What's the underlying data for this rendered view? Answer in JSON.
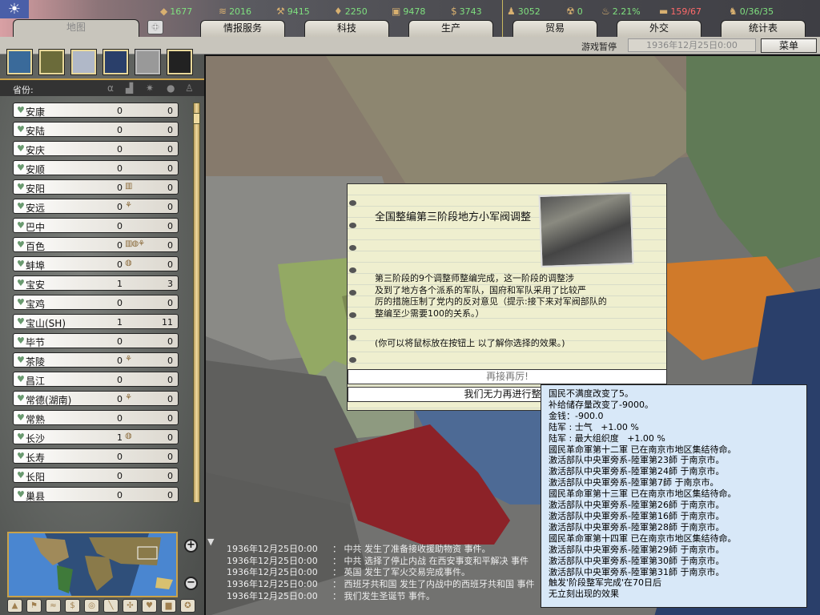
{
  "topbar": {
    "resources": [
      {
        "icon": "energy-icon",
        "value": "1677"
      },
      {
        "icon": "metal-icon",
        "value": "2016"
      },
      {
        "icon": "rare-materials-icon",
        "value": "9415"
      },
      {
        "icon": "oil-icon",
        "value": "2250"
      },
      {
        "icon": "supplies-icon",
        "value": "9478"
      },
      {
        "icon": "money-icon",
        "value": "3743"
      },
      {
        "icon": "manpower-icon",
        "value": "3052"
      },
      {
        "icon": "nuclear-icon",
        "value": "0"
      },
      {
        "icon": "dissent-icon",
        "value": "2.21%"
      },
      {
        "icon": "transport-icon",
        "value": "159/67",
        "color": "#ff6a6a"
      },
      {
        "icon": "officers-icon",
        "value": "0/36/35"
      }
    ],
    "tabs": [
      "地图",
      "情报服务",
      "科技",
      "生产",
      "贸易",
      "外交",
      "统计表"
    ],
    "paused": "游戏暂停",
    "date": "1936年12月25日0:00",
    "menu": "菜单"
  },
  "sidebar": {
    "header": "省份:",
    "rows": [
      {
        "name": "安康",
        "v1": "0",
        "v2": "0",
        "b": ""
      },
      {
        "name": "安陆",
        "v1": "0",
        "v2": "0",
        "b": ""
      },
      {
        "name": "安庆",
        "v1": "0",
        "v2": "0",
        "b": ""
      },
      {
        "name": "安顺",
        "v1": "0",
        "v2": "0",
        "b": ""
      },
      {
        "name": "安阳",
        "v1": "0",
        "v2": "0",
        "b": "▥"
      },
      {
        "name": "安远",
        "v1": "0",
        "v2": "0",
        "b": "⚘"
      },
      {
        "name": "巴中",
        "v1": "0",
        "v2": "0",
        "b": ""
      },
      {
        "name": "百色",
        "v1": "0",
        "v2": "0",
        "b": "▥◍⚘"
      },
      {
        "name": "蚌埠",
        "v1": "0",
        "v2": "0",
        "b": "◍"
      },
      {
        "name": "宝安",
        "v1": "1",
        "v2": "3",
        "b": ""
      },
      {
        "name": "宝鸡",
        "v1": "0",
        "v2": "0",
        "b": ""
      },
      {
        "name": "宝山(SH)",
        "v1": "1",
        "v2": "11",
        "b": ""
      },
      {
        "name": "毕节",
        "v1": "0",
        "v2": "0",
        "b": ""
      },
      {
        "name": "茶陵",
        "v1": "0",
        "v2": "0",
        "b": "⚘"
      },
      {
        "name": "昌江",
        "v1": "0",
        "v2": "0",
        "b": ""
      },
      {
        "name": "常德(湖南)",
        "v1": "0",
        "v2": "0",
        "b": "⚘"
      },
      {
        "name": "常熟",
        "v1": "0",
        "v2": "0",
        "b": ""
      },
      {
        "name": "长沙",
        "v1": "1",
        "v2": "0",
        "b": "◍"
      },
      {
        "name": "长寿",
        "v1": "0",
        "v2": "0",
        "b": ""
      },
      {
        "name": "长阳",
        "v1": "0",
        "v2": "0",
        "b": ""
      },
      {
        "name": "巢县",
        "v1": "0",
        "v2": "0",
        "b": ""
      }
    ]
  },
  "event": {
    "title": "全国整编第三阶段地方小军阀调整",
    "body": [
      "第三阶段的9个调整师整编完成，这一阶段的调整涉",
      "及到了地方各个派系的军队，国府和军队采用了比较严",
      "厉的措施压制了党内的反对意见（提示:接下来对军阀部队的",
      "整编至少需要100的关系。）"
    ],
    "hint": "(你可以将鼠标放在按钮上 以了解你选择的效果。)",
    "option_a": "再接再厉!",
    "option_b": "我们无力再进行整编"
  },
  "tooltip": [
    "国民不满度改变了5。",
    "补给储存量改变了-9000。",
    "金钱：-900.0",
    "陆军 : 士气   +1.00 %",
    "陆军 : 最大组织度   +1.00 %",
    "國民革命軍第十二軍 已在南京市地区集结待命。",
    "激活部队中央軍旁系-陸軍第23師 于南京市。",
    "激活部队中央軍旁系-陸軍第24師 于南京市。",
    "激活部队中央軍旁系-陸軍第7師 于南京市。",
    "國民革命軍第十三軍 已在南京市地区集结待命。",
    "激活部队中央軍旁系-陸軍第26師 于南京市。",
    "激活部队中央軍旁系-陸軍第16師 于南京市。",
    "激活部队中央軍旁系-陸軍第28師 于南京市。",
    "國民革命軍第十四軍 已在南京市地区集结待命。",
    "激活部队中央軍旁系-陸軍第29師 于南京市。",
    "激活部队中央軍旁系-陸軍第30師 于南京市。",
    "激活部队中央軍旁系-陸軍第31師 于南京市。",
    "触发'阶段整军完成'在70日后",
    "无立刻出现的效果"
  ],
  "log": [
    {
      "time": "1936年12月25日0:00",
      "text": "：  中共 发生了准备接收援助物资 事件。"
    },
    {
      "time": "1936年12月25日0:00",
      "text": "：  中共 选择了停止内战 在西安事变和平解决 事件"
    },
    {
      "time": "1936年12月25日0:00",
      "text": "：  英国 发生了军火交易完成事件。"
    },
    {
      "time": "1936年12月25日0:00",
      "text": "：  西班牙共和国 发生了内战中的西班牙共和国 事件"
    },
    {
      "time": "1936年12月25日0:00",
      "text": "：  我们发生圣诞节 事件。"
    }
  ]
}
